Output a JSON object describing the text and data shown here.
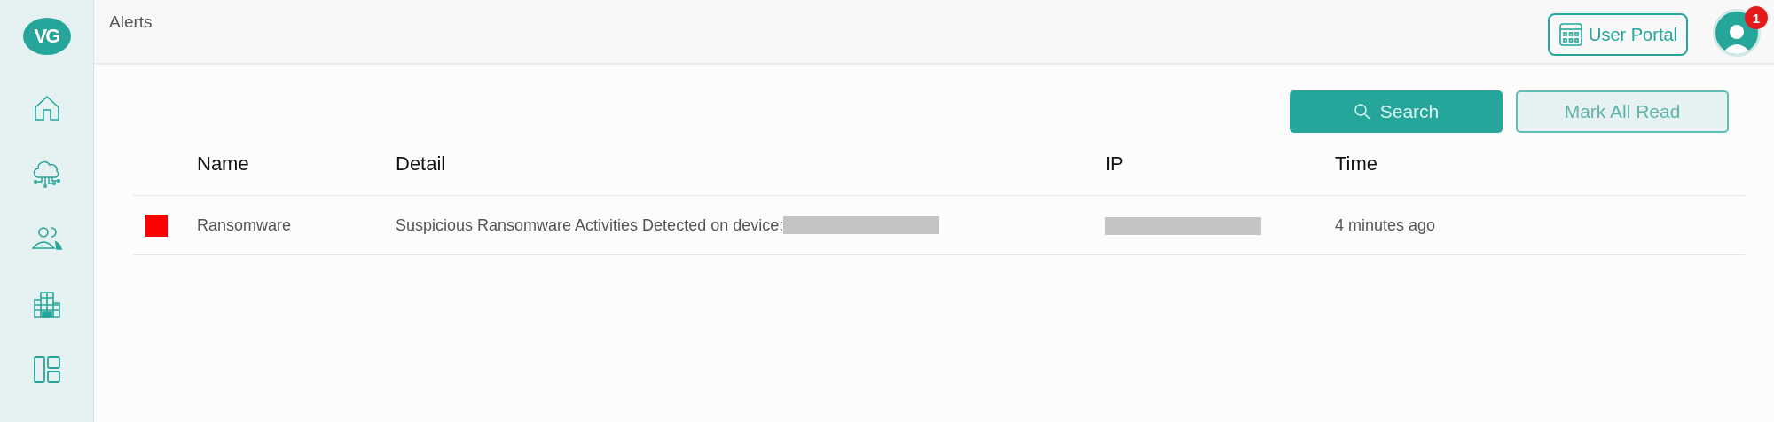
{
  "sidebar": {
    "logo": "VG",
    "items": [
      {
        "kind": "home"
      },
      {
        "kind": "cloud"
      },
      {
        "kind": "users"
      },
      {
        "kind": "building"
      },
      {
        "kind": "layout"
      }
    ]
  },
  "header": {
    "title": "Alerts",
    "portal_button": "User Portal",
    "notification_count": "1"
  },
  "toolbar": {
    "buttons": [
      {
        "label": "Search",
        "kind": "primary"
      },
      {
        "label": "Mark All Read",
        "kind": "secondary"
      }
    ]
  },
  "table": {
    "columns": [
      "Name",
      "Detail",
      "IP",
      "Time"
    ],
    "rows": [
      {
        "color": "#ff0000",
        "name": "Ransomware",
        "detail": "Suspicious Ransomware Activities Detected on device:",
        "detail_redacted": true,
        "ip_redacted": true,
        "time": "4 minutes ago"
      }
    ]
  }
}
